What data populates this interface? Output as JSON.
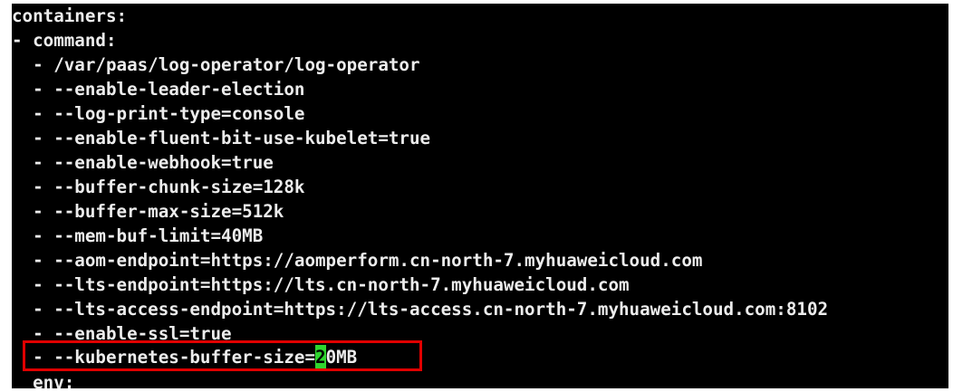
{
  "terminal": {
    "lines": [
      "containers:",
      "- command:",
      "  - /var/paas/log-operator/log-operator",
      "  - --enable-leader-election",
      "  - --log-print-type=console",
      "  - --enable-fluent-bit-use-kubelet=true",
      "  - --enable-webhook=true",
      "  - --buffer-chunk-size=128k",
      "  - --buffer-max-size=512k",
      "  - --mem-buf-limit=40MB",
      "  - --aom-endpoint=https://aomperform.cn-north-7.myhuaweicloud.com",
      "  - --lts-endpoint=https://lts.cn-north-7.myhuaweicloud.com",
      "  - --lts-access-endpoint=https://lts-access.cn-north-7.myhuaweicloud.com:8102",
      "  - --enable-ssl=true"
    ],
    "highlighted_line": {
      "prefix": "  - --kubernetes-buffer-size=",
      "cursor_char": "2",
      "suffix": "0MB"
    },
    "last_line": "  env:"
  },
  "colors": {
    "background": "#000000",
    "text": "#ececec",
    "cursor": "#2fd52f",
    "highlight_border": "#e00000"
  }
}
